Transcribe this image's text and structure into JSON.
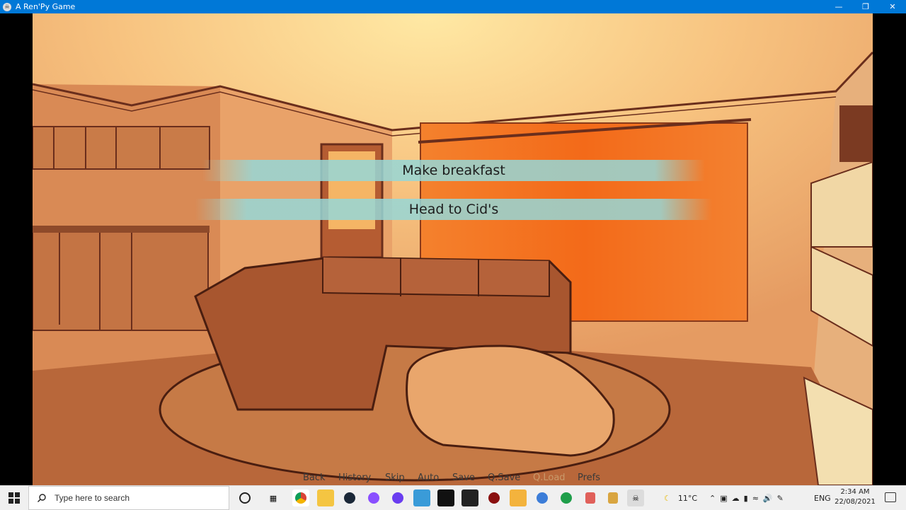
{
  "window": {
    "title": "A Ren'Py Game"
  },
  "choices": [
    "Make breakfast",
    "Head to Cid's"
  ],
  "quick_menu": {
    "back": "Back",
    "history": "History",
    "skip": "Skip",
    "auto": "Auto",
    "save": "Save",
    "qsave": "Q.Save",
    "qload": "Q.Load",
    "prefs": "Prefs"
  },
  "taskbar": {
    "search_placeholder": "Type here to search",
    "weather": "11°C",
    "language": "ENG",
    "time": "2:34 AM",
    "date": "22/08/2021"
  },
  "colors": {
    "taskbar_accent": "#0078d7",
    "choice_bg": "#96d7d7"
  }
}
